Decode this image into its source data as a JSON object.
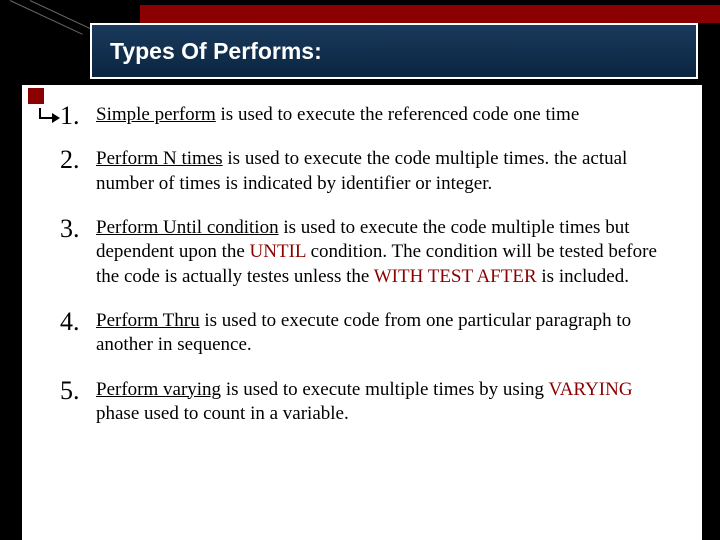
{
  "title": "Types Of Performs:",
  "items": [
    {
      "lead_u": "Simple perform",
      "rest": " is used to execute the referenced code one time"
    },
    {
      "lead_u": "Perform N times",
      "rest": " is used to execute the code multiple times. the actual number of times is indicated by identifier or integer."
    },
    {
      "lead_u": "Perform Until condition",
      "seg1": " is used to execute the code multiple times but dependent upon the ",
      "kw1": "UNTIL",
      "seg2": " condition. The condition will be tested before the code is actually testes unless the ",
      "kw2": "WITH TEST AFTER",
      "seg3": " is included."
    },
    {
      "lead_u": "Perform Thru",
      "rest": " is used to execute code from one particular paragraph to another in sequence."
    },
    {
      "lead_u": "Perform varying",
      "seg1": " is used to execute multiple times by using ",
      "kw1": "VARYING",
      "seg2": " phase used to count in a variable."
    }
  ]
}
